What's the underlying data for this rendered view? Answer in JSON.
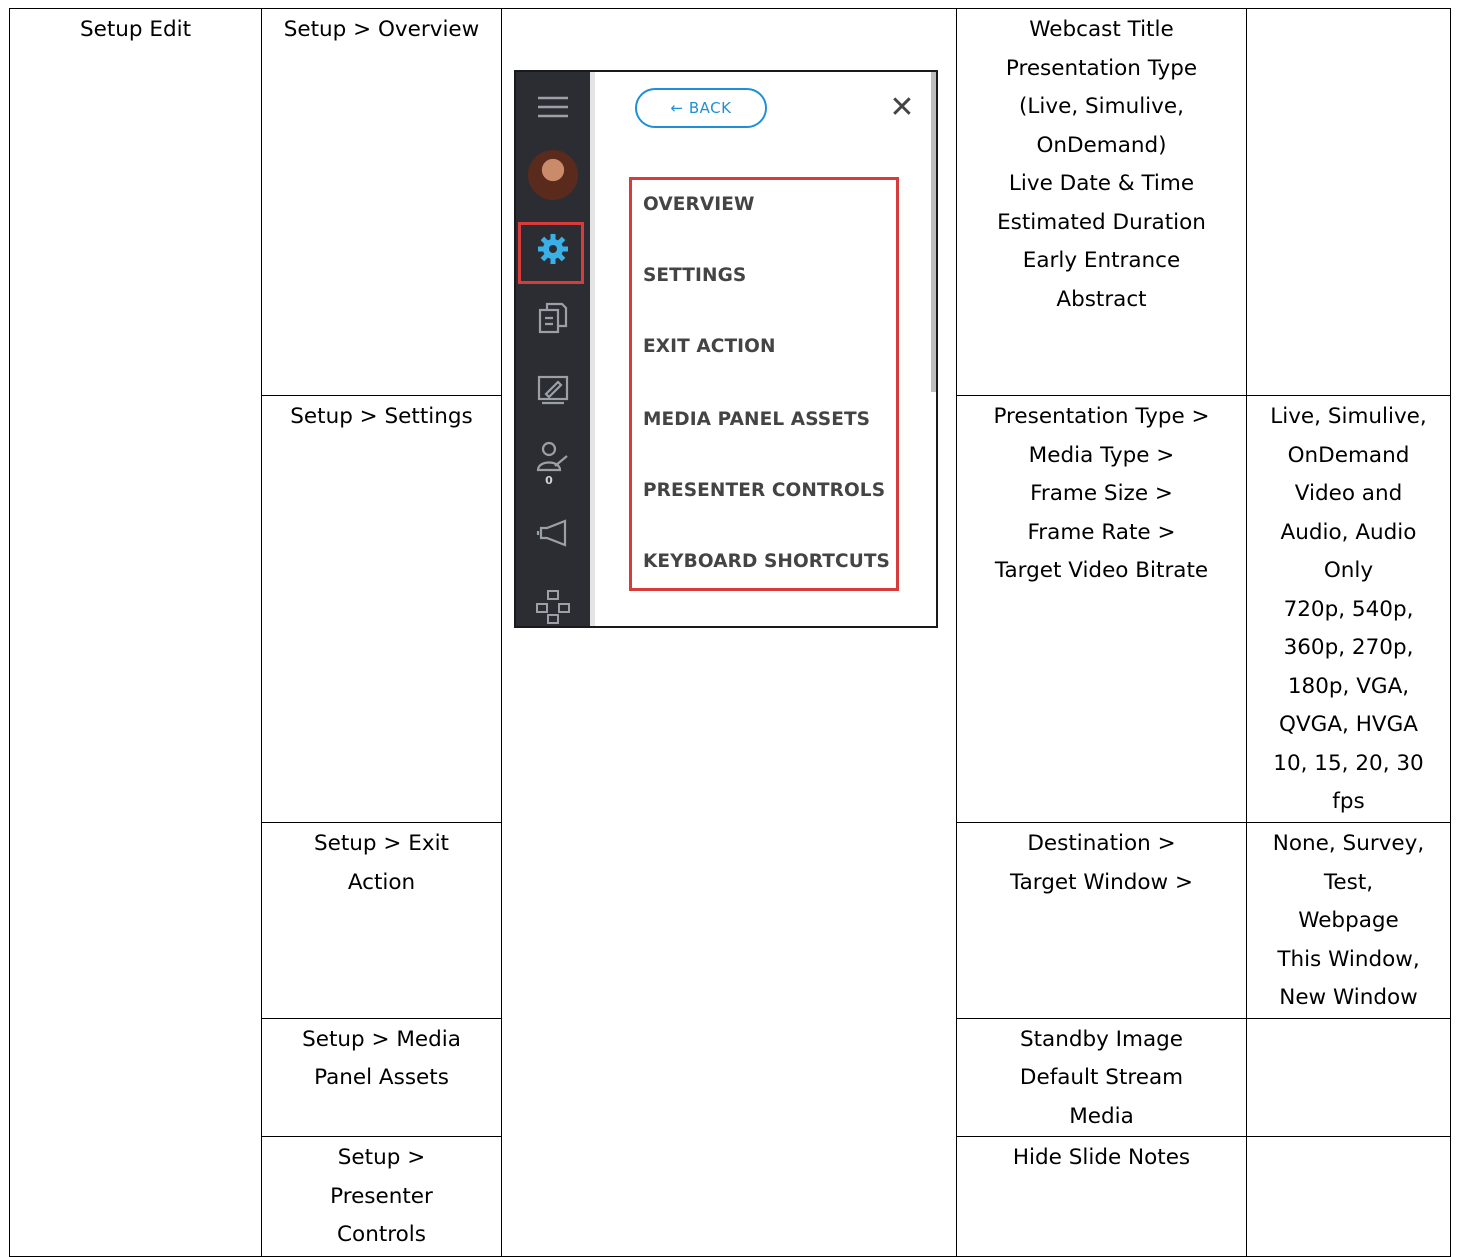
{
  "table": {
    "col1": "Setup Edit",
    "rows": [
      {
        "path_lines": [
          "Setup > Overview"
        ],
        "fields_lines": [
          "Webcast Title",
          "Presentation Type",
          "(Live, Simulive,",
          "OnDemand)",
          "Live Date & Time",
          "Estimated Duration",
          "Early Entrance",
          "Abstract"
        ],
        "options_lines": []
      },
      {
        "path_lines": [
          "Setup > Settings"
        ],
        "fields_lines": [
          "Presentation Type >",
          "Media Type >",
          "Frame Size >",
          "Frame Rate >",
          "Target Video Bitrate"
        ],
        "options_lines": [
          "Live, Simulive,",
          "OnDemand",
          "Video and",
          "Audio, Audio",
          "Only",
          "720p, 540p,",
          "360p, 270p,",
          "180p, VGA,",
          "QVGA, HVGA",
          "10, 15, 20, 30",
          "fps"
        ]
      },
      {
        "path_lines": [
          "Setup > Exit",
          "Action"
        ],
        "fields_lines": [
          "Destination >",
          "Target Window >"
        ],
        "options_lines": [
          "None, Survey,",
          "Test,",
          "Webpage",
          "This Window,",
          "New Window"
        ]
      },
      {
        "path_lines": [
          "Setup > Media",
          "Panel Assets"
        ],
        "fields_lines": [
          "Standby Image",
          "Default Stream",
          "Media"
        ],
        "options_lines": []
      },
      {
        "path_lines": [
          "Setup >",
          "Presenter",
          "Controls"
        ],
        "fields_lines": [
          "Hide Slide Notes"
        ],
        "options_lines": []
      }
    ]
  },
  "screenshot": {
    "back_label": "← BACK",
    "close_glyph": "✕",
    "menu_items": [
      "OVERVIEW",
      "SETTINGS",
      "EXIT ACTION",
      "MEDIA PANEL ASSETS",
      "PRESENTER CONTROLS",
      "KEYBOARD SHORTCUTS"
    ],
    "rail_icons": [
      "hamburger-icon",
      "avatar",
      "gear-icon",
      "copy-icon",
      "edit-icon",
      "user-draw-icon",
      "megaphone-icon",
      "network-icon"
    ],
    "user_badge_count": "0",
    "accent_color": "#1f8fd6",
    "highlight_color": "#d63c3c",
    "rail_color": "#2b2d33"
  }
}
